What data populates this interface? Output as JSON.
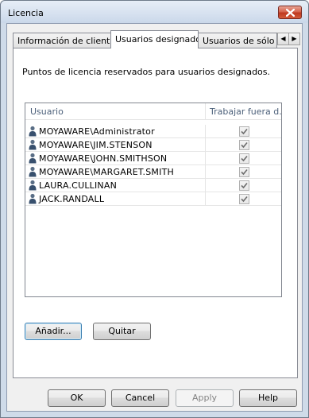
{
  "window": {
    "title": "Licencia"
  },
  "tabs": [
    {
      "label": "Información de cliente",
      "active": false
    },
    {
      "label": "Usuarios designados",
      "active": true
    },
    {
      "label": "Usuarios de sólo lectura",
      "active": false
    }
  ],
  "panel": {
    "description": "Puntos de licencia reservados para usuarios designados."
  },
  "list": {
    "columns": [
      "Usuario",
      "Trabajar fuera d..."
    ],
    "rows": [
      {
        "user": "MOYAWARE\\Administrator",
        "offline": true
      },
      {
        "user": "MOYAWARE\\JIM.STENSON",
        "offline": true
      },
      {
        "user": "MOYAWARE\\JOHN.SMITHSON",
        "offline": true
      },
      {
        "user": "MOYAWARE\\MARGARET.SMITH",
        "offline": true
      },
      {
        "user": "LAURA.CULLINAN",
        "offline": true
      },
      {
        "user": "JACK.RANDALL",
        "offline": true
      }
    ]
  },
  "actions": {
    "add": "Añadir...",
    "remove": "Quitar"
  },
  "footer": {
    "ok": "OK",
    "cancel": "Cancel",
    "apply": "Apply",
    "help": "Help"
  },
  "icons": {
    "close": "close-icon",
    "scroll_left": "chevron-left-icon",
    "scroll_right": "chevron-right-icon",
    "user": "user-icon",
    "check": "checkmark-icon"
  }
}
